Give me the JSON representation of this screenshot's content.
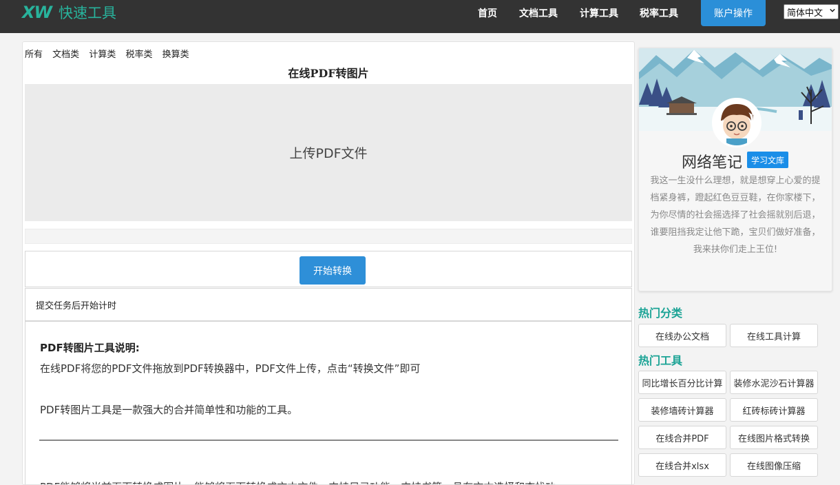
{
  "header": {
    "logo_mark": "XW",
    "logo_text": "快速工具",
    "nav": [
      "首页",
      "文档工具",
      "计算工具",
      "税率工具"
    ],
    "account_button": "账户操作",
    "language": "简体中文",
    "colors": {
      "bar": "#333333",
      "brand": "#28b39c",
      "accent": "#2b8fd8"
    }
  },
  "main": {
    "categories": [
      "所有",
      "文档类",
      "计算类",
      "税率类",
      "换算类"
    ],
    "title": "在线PDF转图片",
    "upload_label": "上传PDF文件",
    "start_button": "开始转换",
    "status": "提交任务后开始计时",
    "description": {
      "heading": "PDF转图片工具说明:",
      "p1": "在线PDF将您的PDF文件拖放到PDF转换器中，PDF文件上传，点击“转换文件”即可",
      "p2": "PDF转图片工具是一款强大的合并简单性和功能的工具。",
      "p3": "PDF能够将当前页面转换成图片，能够将页面转换成文本文件，支持目录功能，支持书签，具有文本选择和查找功"
    }
  },
  "profile": {
    "name": "网络笔记",
    "badge": "学习文库",
    "bio": "我这一生没什么理想，就是想穿上心爱的提档紧身裤，蹬起红色豆豆鞋，在你家楼下，为你尽情的社会摇选择了社会摇就别后退，谁要阻挡我定让他下跪，宝贝们做好准备，我来扶你们走上王位!"
  },
  "hot_categories": {
    "title": "热门分类",
    "items": [
      "在线办公文档",
      "在线工具计算"
    ]
  },
  "hot_tools": {
    "title": "热门工具",
    "items": [
      "同比增长百分比计算",
      "装修水泥沙石计算器",
      "装修墙砖计算器",
      "红砖标砖计算器",
      "在线合并PDF",
      "在线图片格式转换",
      "在线合并xlsx",
      "在线图像压缩"
    ]
  }
}
